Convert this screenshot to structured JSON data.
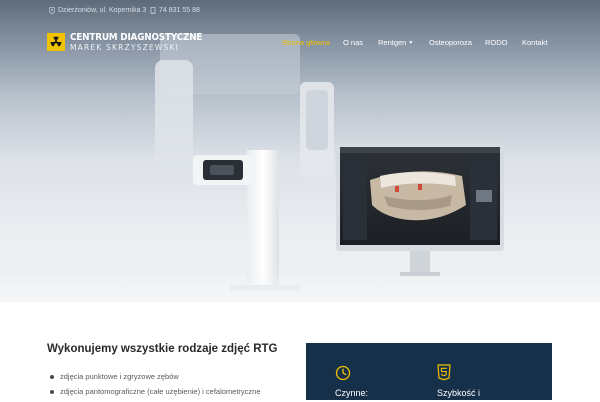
{
  "topbar": {
    "address": "Dzierżoniów, ul. Kopernika 3",
    "phone": "74 831 55 88"
  },
  "logo": {
    "title": "CENTRUM DIAGNOSTYCZNE",
    "subtitle": "MAREK SKRZYSZEWSKI"
  },
  "nav": {
    "items": [
      {
        "label": "Strona główna",
        "active": true
      },
      {
        "label": "O nas"
      },
      {
        "label": "Rentgen",
        "dropdown": true
      },
      {
        "label": "Osteoporoza"
      },
      {
        "label": "RODO"
      },
      {
        "label": "Kontakt"
      }
    ]
  },
  "colors": {
    "accent": "#f2c200",
    "panel": "#17304a",
    "text": "#2a2a2a"
  },
  "content": {
    "title": "Wykonujemy wszystkie rodzaje zdjęć RTG",
    "list": [
      "zdjęcia punktowe i zgryzowe zębów",
      "zdjęcia pantomograficzne (całe uzębienie) i cefalometryczne"
    ]
  },
  "features": [
    {
      "icon": "clock-icon",
      "label": "Czynne:"
    },
    {
      "icon": "html5-icon",
      "label": "Szybkość i"
    }
  ]
}
